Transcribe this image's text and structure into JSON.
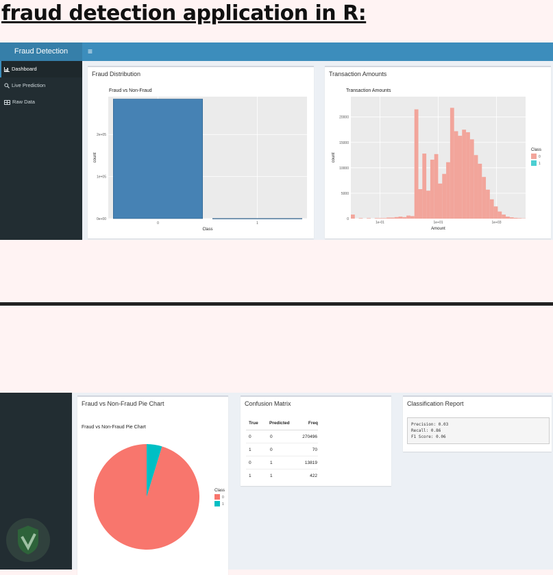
{
  "page": {
    "title": "fraud detection application in R:"
  },
  "app": {
    "brand": "Fraud Detection",
    "menu_icon": "≡"
  },
  "sidebar": {
    "items": [
      {
        "label": "Dashboard",
        "icon": "bar-chart-icon",
        "active": true
      },
      {
        "label": "Live Prediction",
        "icon": "search-icon",
        "active": false
      },
      {
        "label": "Raw Data",
        "icon": "table-icon",
        "active": false
      }
    ]
  },
  "boxes": {
    "fraud_distribution": "Fraud Distribution",
    "transaction_amounts": "Transaction Amounts",
    "pie": "Fraud vs Non-Fraud Pie Chart",
    "confusion": "Confusion Matrix",
    "report": "Classification Report"
  },
  "confusion_matrix": {
    "headers": [
      "True",
      "Predicted",
      "Freq"
    ],
    "rows": [
      [
        "0",
        "0",
        "270496"
      ],
      [
        "1",
        "0",
        "70"
      ],
      [
        "0",
        "1",
        "13819"
      ],
      [
        "1",
        "1",
        "422"
      ]
    ]
  },
  "report": {
    "lines": [
      "Precision: 0.03",
      "Recall: 0.86",
      "F1 Score: 0.06"
    ]
  },
  "colors": {
    "class0": "#f8766d",
    "class1": "#00bfc4",
    "bar": "#4682b4",
    "hist": "#f2a59b"
  },
  "chart_data": [
    {
      "type": "bar",
      "title": "Fraud vs Non-Fraud",
      "xlabel": "Class",
      "ylabel": "count",
      "categories": [
        "0",
        "1"
      ],
      "values": [
        284315,
        492
      ],
      "y_ticks": [
        "0e+00",
        "1e+05",
        "2e+05"
      ],
      "ylim": [
        0,
        290000
      ],
      "grid": true
    },
    {
      "type": "bar",
      "title": "Transaction Amounts",
      "xlabel": "Amount",
      "ylabel": "count",
      "x_scale": "log10",
      "x_ticks": [
        "1e-01",
        "1e+01",
        "1e+03"
      ],
      "y_ticks": [
        "0",
        "5000",
        "10000",
        "15000",
        "20000"
      ],
      "ylim": [
        0,
        24000
      ],
      "legend_title": "Class",
      "legend": [
        "0",
        "1"
      ],
      "legend_position": "right",
      "bins_log10": [
        -2.0,
        -1.0,
        0.0,
        1.0,
        2.0,
        3.0,
        4.0
      ],
      "values": [
        800,
        0,
        100,
        0,
        100,
        0,
        100,
        100,
        100,
        200,
        200,
        300,
        400,
        300,
        600,
        500,
        21500,
        5800,
        12800,
        5500,
        11600,
        12700,
        6900,
        8800,
        11100,
        21800,
        17200,
        16300,
        17500,
        17000,
        15600,
        12500,
        10800,
        8200,
        5700,
        3800,
        2400,
        1400,
        800,
        400,
        250,
        150,
        100,
        50
      ],
      "grid": true
    },
    {
      "type": "pie",
      "title": "Fraud vs Non-Fraud Pie Chart",
      "legend_title": "Class",
      "legend": [
        "0",
        "1"
      ],
      "legend_position": "right",
      "labels": [
        "0",
        "1"
      ],
      "values": [
        95.3,
        4.7
      ]
    }
  ]
}
